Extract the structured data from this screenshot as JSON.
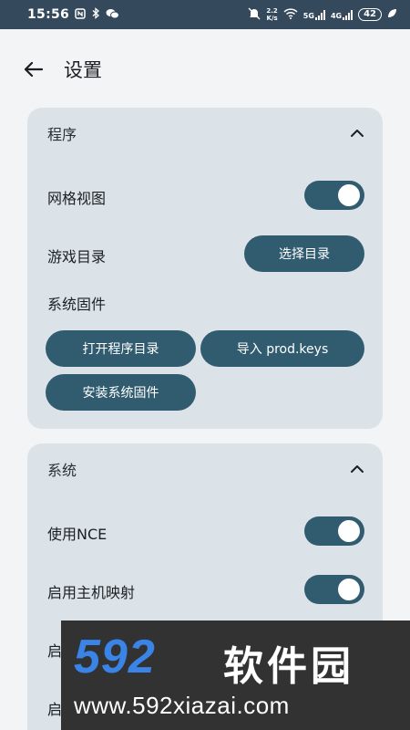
{
  "status_bar": {
    "time": "15:56",
    "net_speed_value": "2.2",
    "net_speed_unit": "K/s",
    "signal_1": "5G",
    "signal_2": "4G",
    "battery": "42"
  },
  "app_bar": {
    "title": "设置"
  },
  "section_program": {
    "title": "程序",
    "grid_view_label": "网格视图",
    "grid_view_on": true,
    "game_dir_label": "游戏目录",
    "choose_dir_button": "选择目录",
    "firmware_label": "系统固件",
    "open_program_dir_button": "打开程序目录",
    "import_keys_button": "导入 prod.keys",
    "install_firmware_button": "安装系统固件"
  },
  "section_system": {
    "title": "系统",
    "use_nce_label": "使用NCE",
    "use_nce_on": true,
    "host_mapping_label": "启用主机映射",
    "host_mapping_on": true,
    "row3_label": "启",
    "row4_label": "启"
  },
  "watermark": {
    "brand_num": "592",
    "brand_cn": "软件园",
    "url": "www.592xiazai.com"
  },
  "colors": {
    "status_bar": "#34495c",
    "accent": "#315c70",
    "card_bg": "#dce3e8",
    "page_bg": "#f2f4f5"
  }
}
